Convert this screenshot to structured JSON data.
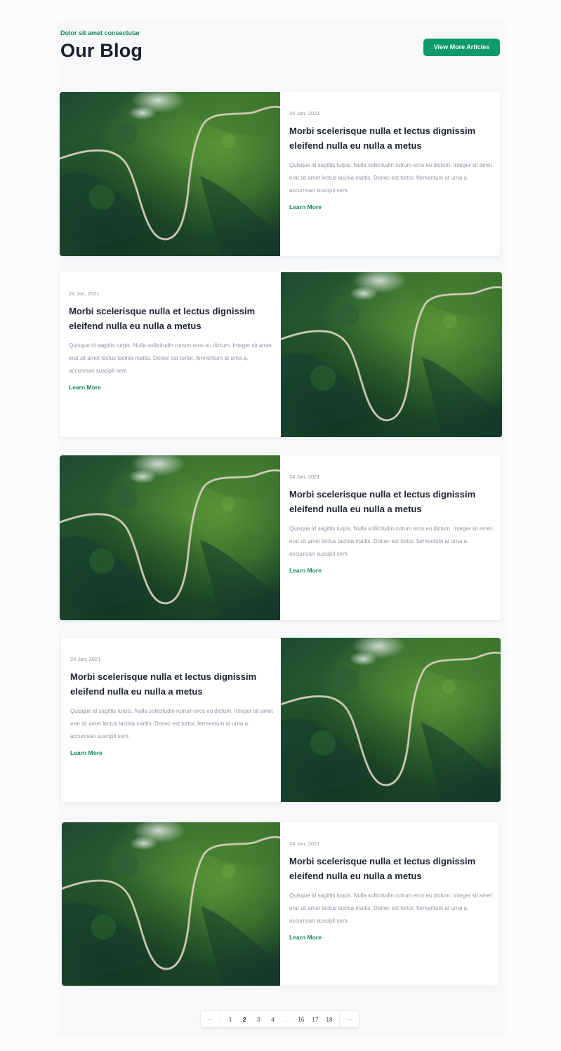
{
  "header": {
    "eyebrow": "Dolor sit amet consectutar",
    "title": "Our Blog",
    "view_more_label": "View More Articles"
  },
  "posts": [
    {
      "date": "24 Jan, 2021",
      "title": "Morbi scelerisque nulla et lectus dignissim eleifend nulla eu nulla a metus",
      "excerpt": "Quisque id sagittis turpis. Nulla sollicitudin rutrum eros eu dictum. Integer sit amet erat sit amet lectus lacinia mattis. Donec est tortor, fermentum at urna a, accumsan suscipit sem.",
      "link_label": "Learn More",
      "image_side": "left"
    },
    {
      "date": "24 Jan, 2021",
      "title": "Morbi scelerisque nulla et lectus dignissim eleifend nulla eu nulla a metus",
      "excerpt": "Quisque id sagittis turpis. Nulla sollicitudin rutrum eros eu dictum. Integer sit amet erat sit amet lectus lacinia mattis. Donec est tortor, fermentum at urna a, accumsan suscipit sem.",
      "link_label": "Learn More",
      "image_side": "right"
    },
    {
      "date": "24 Jan, 2021",
      "title": "Morbi scelerisque nulla et lectus dignissim eleifend nulla eu nulla a metus",
      "excerpt": "Quisque id sagittis turpis. Nulla sollicitudin rutrum eros eu dictum. Integer sit amet erat sit amet lectus lacinia mattis. Donec est tortor, fermentum at urna a, accumsan suscipit sem.",
      "link_label": "Learn More",
      "image_side": "left"
    },
    {
      "date": "24 Jan, 2021",
      "title": "Morbi scelerisque nulla et lectus dignissim eleifend nulla eu nulla a metus",
      "excerpt": "Quisque id sagittis turpis. Nulla sollicitudin rutrum eros eu dictum. Integer sit amet erat sit amet lectus lacinia mattis. Donec est tortor, fermentum at urna a, accumsan suscipit sem.",
      "link_label": "Learn More",
      "image_side": "right"
    },
    {
      "date": "24 Jan, 2021",
      "title": "Morbi scelerisque nulla et lectus dignissim eleifend nulla eu nulla a metus",
      "excerpt": "Quisque id sagittis turpis. Nulla sollicitudin rutrum eros eu dictum. Integer sit amet erat sit amet lectus lacinia mattis. Donec est tortor, fermentum at urna a, accumsan suscipit sem.",
      "link_label": "Learn More",
      "image_side": "left"
    }
  ],
  "pagination": {
    "prev_icon": "arrow-left-icon",
    "next_icon": "arrow-right-icon",
    "prev_glyph": "←",
    "next_glyph": "→",
    "pages": [
      "1",
      "2",
      "3",
      "4",
      "...",
      "16",
      "17",
      "18"
    ],
    "current": "2"
  },
  "colors": {
    "accent": "#0f9a6a",
    "accent_text": "#0f8a5f",
    "heading": "#17202c",
    "muted": "#8d97a5"
  }
}
